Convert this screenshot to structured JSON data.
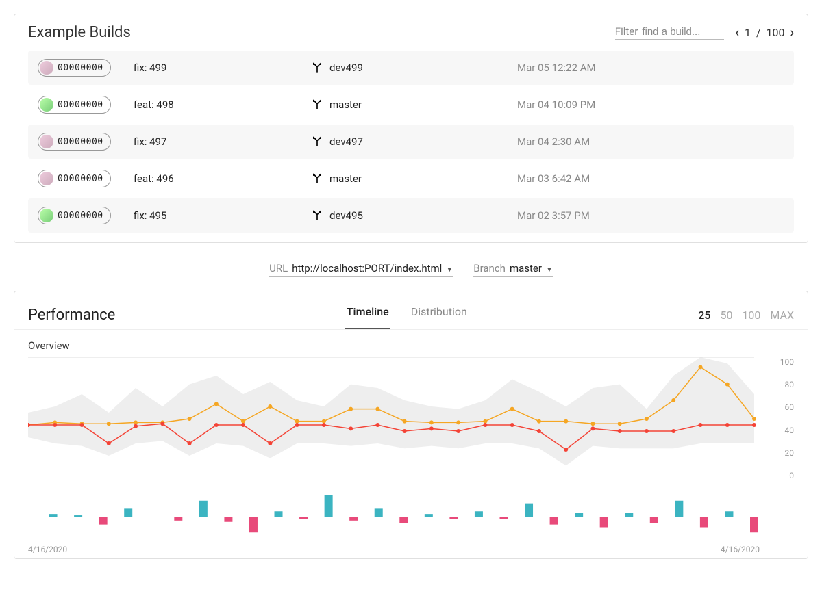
{
  "builds_panel": {
    "title": "Example Builds",
    "filter_label": "Filter",
    "filter_placeholder": "find a build...",
    "page_current": "1",
    "page_total": "100",
    "rows": [
      {
        "hash": "00000000",
        "message": "fix: 499",
        "branch": "dev499",
        "date": "Mar 05 12:22 AM",
        "avatar": "a2"
      },
      {
        "hash": "00000000",
        "message": "feat: 498",
        "branch": "master",
        "date": "Mar 04 10:09 PM",
        "avatar": "a1"
      },
      {
        "hash": "00000000",
        "message": "fix: 497",
        "branch": "dev497",
        "date": "Mar 04 2:30 AM",
        "avatar": "a2"
      },
      {
        "hash": "00000000",
        "message": "feat: 496",
        "branch": "master",
        "date": "Mar 03 6:42 AM",
        "avatar": "a2"
      },
      {
        "hash": "00000000",
        "message": "fix: 495",
        "branch": "dev495",
        "date": "Mar 02 3:57 PM",
        "avatar": "a1"
      }
    ]
  },
  "selectors": {
    "url_label": "URL",
    "url_value": "http://localhost:PORT/index.html",
    "branch_label": "Branch",
    "branch_value": "master"
  },
  "perf_panel": {
    "title": "Performance",
    "tabs": {
      "timeline": "Timeline",
      "distribution": "Distribution"
    },
    "active_tab": "timeline",
    "ranges": [
      "25",
      "50",
      "100",
      "MAX"
    ],
    "active_range": "25",
    "overview_label": "Overview",
    "x_start": "4/16/2020",
    "x_end": "4/16/2020"
  },
  "chart_data": {
    "overview": {
      "type": "line",
      "ylim": [
        0,
        100
      ],
      "y_ticks": [
        100,
        80,
        60,
        40,
        20,
        0
      ],
      "series": [
        {
          "name": "upper",
          "color": "#f5a623",
          "values": [
            45,
            47,
            46,
            46,
            47,
            47,
            50,
            62,
            48,
            60,
            48,
            48,
            58,
            58,
            48,
            47,
            47,
            48,
            58,
            48,
            48,
            46,
            46,
            50,
            65,
            92,
            78,
            50
          ]
        },
        {
          "name": "lower",
          "color": "#f44336",
          "values": [
            45,
            45,
            45,
            30,
            44,
            46,
            30,
            45,
            45,
            30,
            45,
            45,
            42,
            45,
            40,
            42,
            40,
            45,
            45,
            40,
            25,
            42,
            40,
            40,
            40,
            45,
            45,
            45
          ]
        }
      ],
      "band": {
        "upper": [
          55,
          60,
          70,
          55,
          75,
          60,
          78,
          85,
          70,
          80,
          65,
          60,
          78,
          75,
          65,
          60,
          58,
          65,
          82,
          72,
          60,
          75,
          78,
          58,
          85,
          100,
          95,
          70
        ],
        "lower": [
          35,
          30,
          28,
          20,
          30,
          32,
          20,
          30,
          28,
          18,
          30,
          30,
          28,
          30,
          26,
          28,
          26,
          30,
          30,
          26,
          12,
          28,
          26,
          26,
          26,
          30,
          30,
          30
        ]
      }
    },
    "diff_bars": {
      "type": "bar",
      "values": [
        0,
        2,
        1,
        -6,
        6,
        0,
        -3,
        12,
        -4,
        -12,
        4,
        -2,
        16,
        -3,
        6,
        -5,
        2,
        -2,
        4,
        -2,
        10,
        -6,
        3,
        -8,
        3,
        -5,
        12,
        -8,
        4,
        -12
      ]
    }
  }
}
